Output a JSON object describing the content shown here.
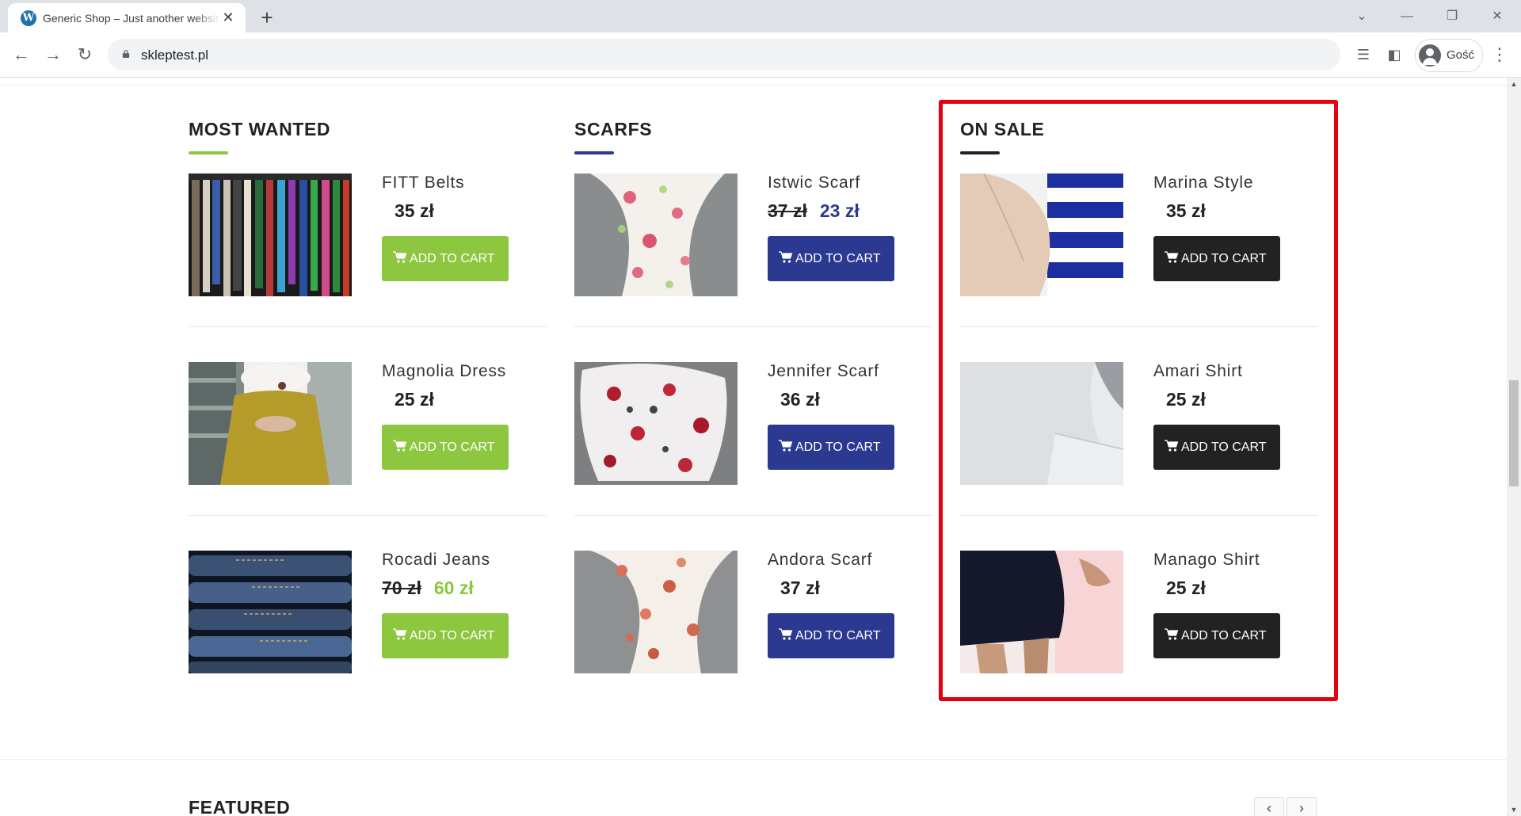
{
  "browser": {
    "tab_title": "Generic Shop – Just another website",
    "tab_favicon": "wordpress-icon",
    "new_tab_label": "+",
    "url": "skleptest.pl",
    "profile_name": "Gość"
  },
  "columns": [
    {
      "title": "MOST WANTED",
      "accent": "#8dc63f",
      "button_color": "#8dc63f",
      "sale_color": "#8dc63f",
      "products": [
        {
          "name": "FITT Belts",
          "old_price": "",
          "price": "35 zł",
          "button": "ADD TO CART"
        },
        {
          "name": "Magnolia Dress",
          "old_price": "",
          "price": "25 zł",
          "button": "ADD TO CART"
        },
        {
          "name": "Rocadi Jeans",
          "old_price": "70 zł",
          "price": "60 zł",
          "button": "ADD TO CART"
        }
      ]
    },
    {
      "title": "SCARFS",
      "accent": "#2b3990",
      "button_color": "#2b3990",
      "sale_color": "#2b3990",
      "products": [
        {
          "name": "Istwic Scarf",
          "old_price": "37 zł",
          "price": "23 zł",
          "button": "ADD TO CART"
        },
        {
          "name": "Jennifer Scarf",
          "old_price": "",
          "price": "36 zł",
          "button": "ADD TO CART"
        },
        {
          "name": "Andora Scarf",
          "old_price": "",
          "price": "37 zł",
          "button": "ADD TO CART"
        }
      ]
    },
    {
      "title": "ON SALE",
      "accent": "#222222",
      "button_color": "#222222",
      "sale_color": "#222222",
      "products": [
        {
          "name": "Marina Style",
          "old_price": "",
          "price": "35 zł",
          "button": "ADD TO CART"
        },
        {
          "name": "Amari Shirt",
          "old_price": "",
          "price": "25 zł",
          "button": "ADD TO CART"
        },
        {
          "name": "Manago Shirt",
          "old_price": "",
          "price": "25 zł",
          "button": "ADD TO CART"
        }
      ]
    }
  ],
  "featured": {
    "title": "FEATURED",
    "prev_label": "‹",
    "next_label": "›"
  },
  "highlight_color": "#e3000f"
}
